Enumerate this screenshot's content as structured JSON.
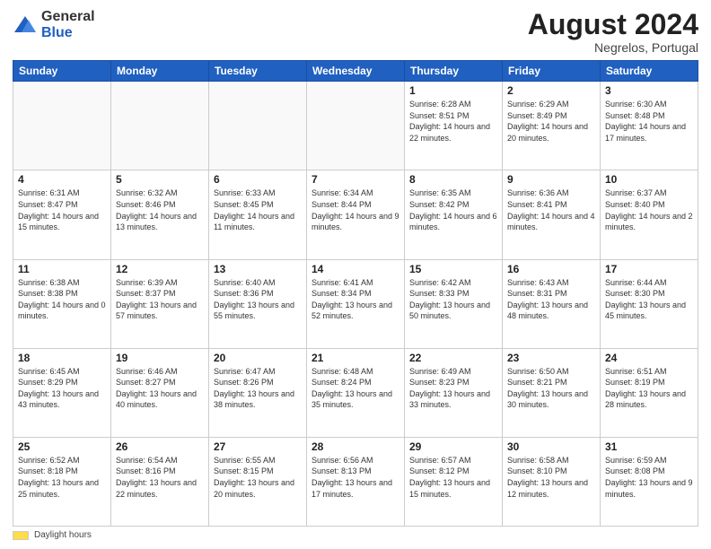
{
  "logo": {
    "general": "General",
    "blue": "Blue"
  },
  "title": {
    "month_year": "August 2024",
    "location": "Negrelos, Portugal"
  },
  "days_of_week": [
    "Sunday",
    "Monday",
    "Tuesday",
    "Wednesday",
    "Thursday",
    "Friday",
    "Saturday"
  ],
  "footer": {
    "label": "Daylight hours"
  },
  "weeks": [
    [
      {
        "day": "",
        "info": ""
      },
      {
        "day": "",
        "info": ""
      },
      {
        "day": "",
        "info": ""
      },
      {
        "day": "",
        "info": ""
      },
      {
        "day": "1",
        "info": "Sunrise: 6:28 AM\nSunset: 8:51 PM\nDaylight: 14 hours and 22 minutes."
      },
      {
        "day": "2",
        "info": "Sunrise: 6:29 AM\nSunset: 8:49 PM\nDaylight: 14 hours and 20 minutes."
      },
      {
        "day": "3",
        "info": "Sunrise: 6:30 AM\nSunset: 8:48 PM\nDaylight: 14 hours and 17 minutes."
      }
    ],
    [
      {
        "day": "4",
        "info": "Sunrise: 6:31 AM\nSunset: 8:47 PM\nDaylight: 14 hours and 15 minutes."
      },
      {
        "day": "5",
        "info": "Sunrise: 6:32 AM\nSunset: 8:46 PM\nDaylight: 14 hours and 13 minutes."
      },
      {
        "day": "6",
        "info": "Sunrise: 6:33 AM\nSunset: 8:45 PM\nDaylight: 14 hours and 11 minutes."
      },
      {
        "day": "7",
        "info": "Sunrise: 6:34 AM\nSunset: 8:44 PM\nDaylight: 14 hours and 9 minutes."
      },
      {
        "day": "8",
        "info": "Sunrise: 6:35 AM\nSunset: 8:42 PM\nDaylight: 14 hours and 6 minutes."
      },
      {
        "day": "9",
        "info": "Sunrise: 6:36 AM\nSunset: 8:41 PM\nDaylight: 14 hours and 4 minutes."
      },
      {
        "day": "10",
        "info": "Sunrise: 6:37 AM\nSunset: 8:40 PM\nDaylight: 14 hours and 2 minutes."
      }
    ],
    [
      {
        "day": "11",
        "info": "Sunrise: 6:38 AM\nSunset: 8:38 PM\nDaylight: 14 hours and 0 minutes."
      },
      {
        "day": "12",
        "info": "Sunrise: 6:39 AM\nSunset: 8:37 PM\nDaylight: 13 hours and 57 minutes."
      },
      {
        "day": "13",
        "info": "Sunrise: 6:40 AM\nSunset: 8:36 PM\nDaylight: 13 hours and 55 minutes."
      },
      {
        "day": "14",
        "info": "Sunrise: 6:41 AM\nSunset: 8:34 PM\nDaylight: 13 hours and 52 minutes."
      },
      {
        "day": "15",
        "info": "Sunrise: 6:42 AM\nSunset: 8:33 PM\nDaylight: 13 hours and 50 minutes."
      },
      {
        "day": "16",
        "info": "Sunrise: 6:43 AM\nSunset: 8:31 PM\nDaylight: 13 hours and 48 minutes."
      },
      {
        "day": "17",
        "info": "Sunrise: 6:44 AM\nSunset: 8:30 PM\nDaylight: 13 hours and 45 minutes."
      }
    ],
    [
      {
        "day": "18",
        "info": "Sunrise: 6:45 AM\nSunset: 8:29 PM\nDaylight: 13 hours and 43 minutes."
      },
      {
        "day": "19",
        "info": "Sunrise: 6:46 AM\nSunset: 8:27 PM\nDaylight: 13 hours and 40 minutes."
      },
      {
        "day": "20",
        "info": "Sunrise: 6:47 AM\nSunset: 8:26 PM\nDaylight: 13 hours and 38 minutes."
      },
      {
        "day": "21",
        "info": "Sunrise: 6:48 AM\nSunset: 8:24 PM\nDaylight: 13 hours and 35 minutes."
      },
      {
        "day": "22",
        "info": "Sunrise: 6:49 AM\nSunset: 8:23 PM\nDaylight: 13 hours and 33 minutes."
      },
      {
        "day": "23",
        "info": "Sunrise: 6:50 AM\nSunset: 8:21 PM\nDaylight: 13 hours and 30 minutes."
      },
      {
        "day": "24",
        "info": "Sunrise: 6:51 AM\nSunset: 8:19 PM\nDaylight: 13 hours and 28 minutes."
      }
    ],
    [
      {
        "day": "25",
        "info": "Sunrise: 6:52 AM\nSunset: 8:18 PM\nDaylight: 13 hours and 25 minutes."
      },
      {
        "day": "26",
        "info": "Sunrise: 6:54 AM\nSunset: 8:16 PM\nDaylight: 13 hours and 22 minutes."
      },
      {
        "day": "27",
        "info": "Sunrise: 6:55 AM\nSunset: 8:15 PM\nDaylight: 13 hours and 20 minutes."
      },
      {
        "day": "28",
        "info": "Sunrise: 6:56 AM\nSunset: 8:13 PM\nDaylight: 13 hours and 17 minutes."
      },
      {
        "day": "29",
        "info": "Sunrise: 6:57 AM\nSunset: 8:12 PM\nDaylight: 13 hours and 15 minutes."
      },
      {
        "day": "30",
        "info": "Sunrise: 6:58 AM\nSunset: 8:10 PM\nDaylight: 13 hours and 12 minutes."
      },
      {
        "day": "31",
        "info": "Sunrise: 6:59 AM\nSunset: 8:08 PM\nDaylight: 13 hours and 9 minutes."
      }
    ]
  ]
}
